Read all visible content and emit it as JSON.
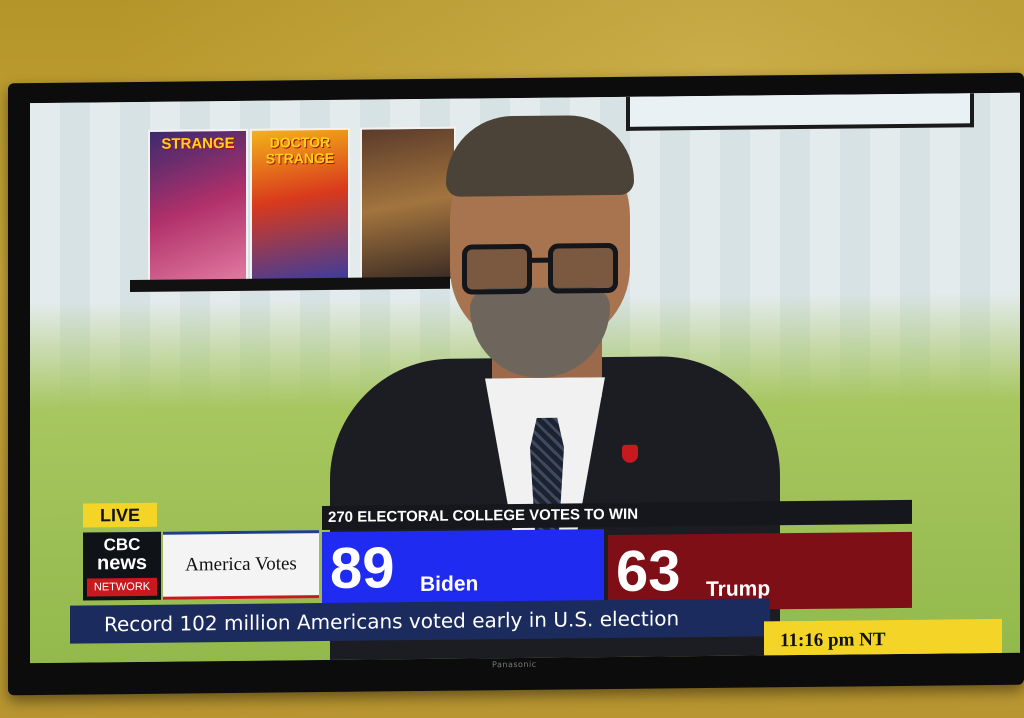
{
  "broadcast": {
    "live_label": "LIVE",
    "network_logo": {
      "line1": "CBC",
      "line2": "news",
      "sub": "NETWORK"
    },
    "program_title": "America Votes",
    "electoral_header": "270 ELECTORAL COLLEGE VOTES TO WIN",
    "candidates": [
      {
        "name": "Biden",
        "votes": "89",
        "color": "#1f2bf0"
      },
      {
        "name": "Trump",
        "votes": "63",
        "color": "#7e0f16"
      }
    ],
    "ticker_text": "Record 102 million Americans voted early in U.S. election",
    "clock": "11:16 pm NT"
  },
  "scene": {
    "tv_brand": "Panasonic",
    "comics": [
      {
        "title": "STRANGE"
      },
      {
        "title": "DOCTOR STRANGE"
      },
      {
        "title": ""
      }
    ]
  }
}
